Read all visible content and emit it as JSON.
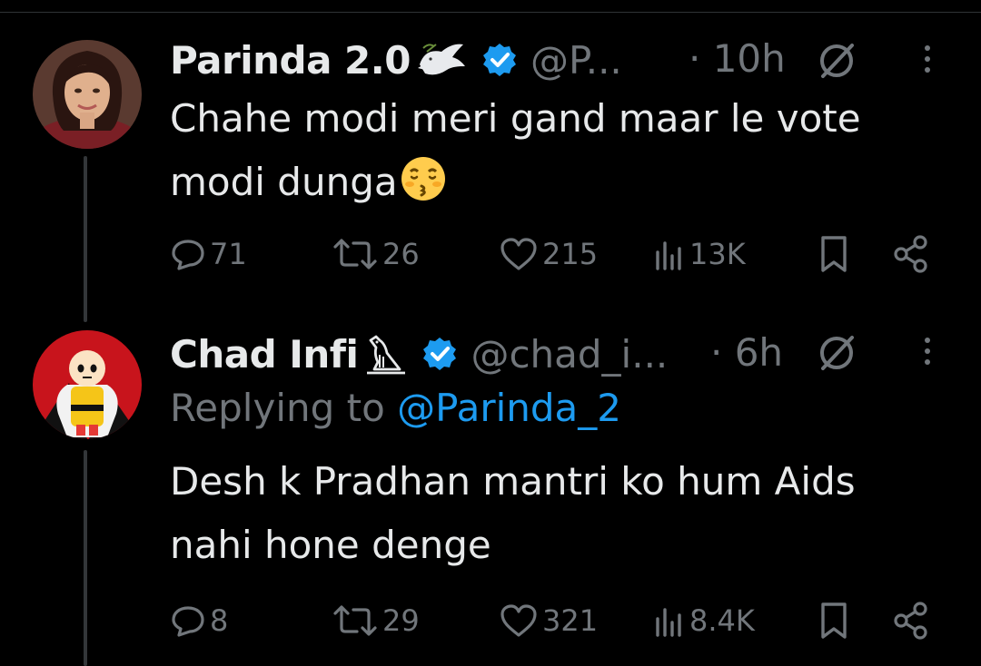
{
  "tweets": [
    {
      "display_name": "Parinda 2.0",
      "name_emoji": "dove-icon",
      "handle": "@P...",
      "time": "· 10h",
      "text_line1": "Chahe modi meri gand maar le vote",
      "text_line2": "modi dunga",
      "text_emoji": "kissing-face-icon",
      "stats": {
        "replies": "71",
        "retweets": "26",
        "likes": "215",
        "views": "13K"
      }
    },
    {
      "display_name": "Chad Infi",
      "name_emoji": "bird-icon",
      "handle": "@chad_i...",
      "time": "· 6h",
      "replying_label": "Replying to",
      "replying_handle": "@Parinda_2",
      "text_line1": "Desh k Pradhan mantri ko hum Aids",
      "text_line2": "nahi hone denge",
      "stats": {
        "replies": "8",
        "retweets": "29",
        "likes": "321",
        "views": "8.4K"
      }
    }
  ],
  "colors": {
    "background": "#000000",
    "text": "#e7e9ea",
    "muted": "#71767b",
    "verified": "#1d9bf0",
    "link": "#1d9bf0"
  }
}
